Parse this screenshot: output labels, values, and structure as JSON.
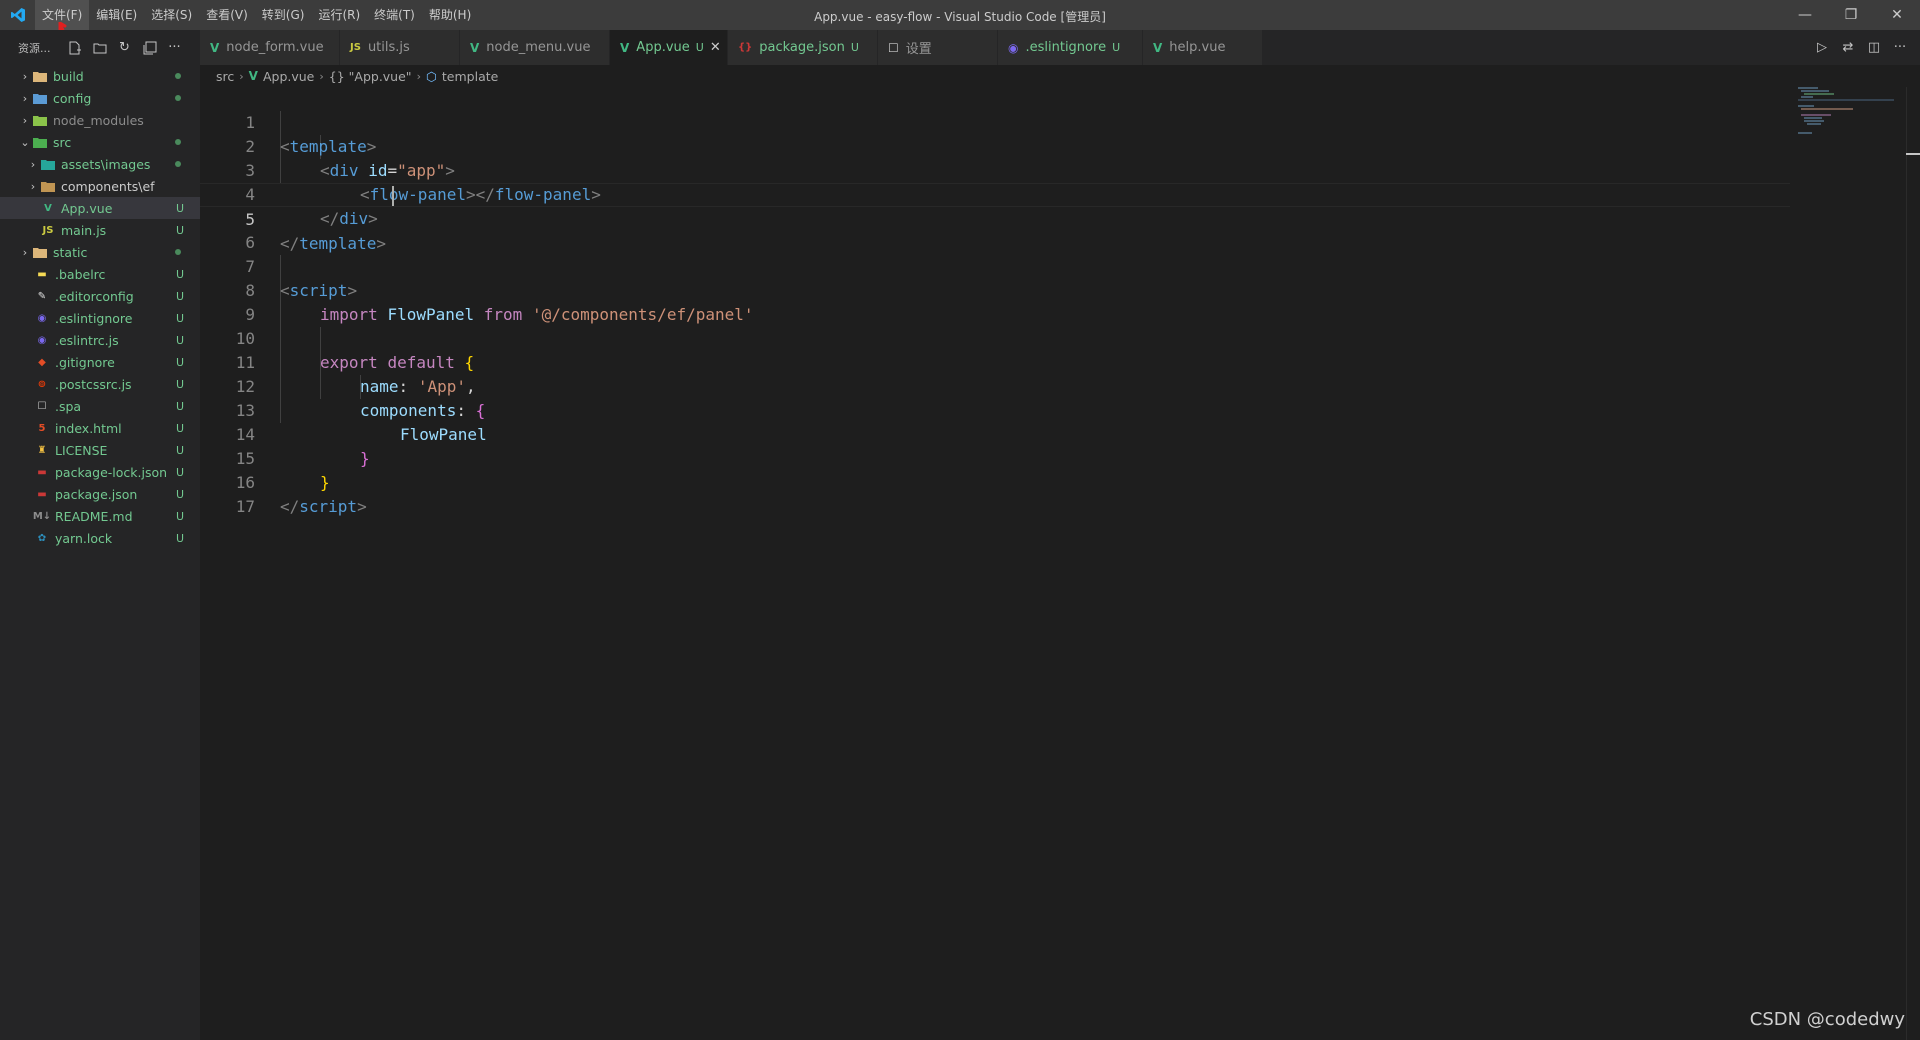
{
  "window": {
    "title": "App.vue - easy-flow - Visual Studio Code [管理员]",
    "logo_icon": "vscode-logo-icon",
    "accent": "#007acc"
  },
  "menu": [
    "文件(F)",
    "编辑(E)",
    "选择(S)",
    "查看(V)",
    "转到(G)",
    "运行(R)",
    "终端(T)",
    "帮助(H)"
  ],
  "window_controls": {
    "minimize": "—",
    "restore": "❐",
    "close": "✕"
  },
  "sidebar": {
    "title": "资源...",
    "tree": [
      {
        "name": "build",
        "status": "dot"
      },
      {
        "name": "config",
        "status": "dot"
      },
      {
        "name": "node_modules",
        "status": ""
      },
      {
        "name": "src",
        "status": "dot"
      },
      {
        "name": "assets\\images",
        "status": "dot"
      },
      {
        "name": "components\\ef",
        "status": ""
      },
      {
        "name": "App.vue",
        "status": "U"
      },
      {
        "name": "main.js",
        "status": "U"
      },
      {
        "name": "static",
        "status": "dot"
      },
      {
        "name": ".babelrc",
        "status": "U"
      },
      {
        "name": ".editorconfig",
        "status": "U"
      },
      {
        "name": ".eslintignore",
        "status": "U"
      },
      {
        "name": ".eslintrc.js",
        "status": "U"
      },
      {
        "name": ".gitignore",
        "status": "U"
      },
      {
        "name": ".postcssrc.js",
        "status": "U"
      },
      {
        "name": ".spa",
        "status": "U"
      },
      {
        "name": "index.html",
        "status": "U"
      },
      {
        "name": "LICENSE",
        "status": "U"
      },
      {
        "name": "package-lock.json",
        "status": "U"
      },
      {
        "name": "package.json",
        "status": "U"
      },
      {
        "name": "README.md",
        "status": "U"
      },
      {
        "name": "yarn.lock",
        "status": "U"
      }
    ]
  },
  "tabs": [
    {
      "label": "node_form.vue",
      "icon": "V",
      "mark": ""
    },
    {
      "label": "utils.js",
      "icon": "JS",
      "mark": ""
    },
    {
      "label": "node_menu.vue",
      "icon": "V",
      "mark": ""
    },
    {
      "label": "App.vue",
      "icon": "V",
      "mark": "U"
    },
    {
      "label": "package.json",
      "icon": "{}",
      "mark": "U"
    },
    {
      "label": "设置",
      "icon": "☐",
      "mark": ""
    },
    {
      "label": ".eslintignore",
      "icon": "◉",
      "mark": "U"
    },
    {
      "label": "help.vue",
      "icon": "V",
      "mark": ""
    }
  ],
  "breadcrumb": [
    "src",
    "App.vue",
    "{} \"App.vue\"",
    "template"
  ],
  "editor": {
    "line_numbers": [
      "1",
      "2",
      "3",
      "4",
      "5",
      "6",
      "7",
      "8",
      "9",
      "10",
      "11",
      "12",
      "13",
      "14",
      "15",
      "16",
      "17"
    ],
    "current_line": "5",
    "code": {
      "l1": {
        "a": "<",
        "b": "template",
        "c": ">"
      },
      "l2": {
        "a": "<",
        "b": "div",
        "c": "id",
        "d": "=",
        "e": "\"app\"",
        "f": ">"
      },
      "l3": {
        "a": "<",
        "b": "flow-panel",
        "c": "></",
        "d": "flow-panel",
        "e": ">"
      },
      "l4": {
        "a": "</",
        "b": "div",
        "c": ">"
      },
      "l5": {
        "a": "</",
        "b": "template",
        "c": ">"
      },
      "l7": {
        "a": "<",
        "b": "script",
        "c": ">"
      },
      "l8": {
        "a": "import",
        "b": "FlowPanel",
        "c": "from",
        "d": "'@/components/ef/panel'"
      },
      "l10": {
        "a": "export",
        "b": "default",
        "c": "{"
      },
      "l11": {
        "a": "name",
        "b": ":",
        "c": "'App'",
        "d": ","
      },
      "l12": {
        "a": "components",
        "b": ":",
        "c": "{"
      },
      "l13": {
        "a": "FlowPanel"
      },
      "l14": {
        "a": "}"
      },
      "l15": {
        "a": "}"
      },
      "l16": {
        "a": "</",
        "b": "script",
        "c": ">"
      }
    }
  },
  "watermark": "CSDN @codedwy"
}
